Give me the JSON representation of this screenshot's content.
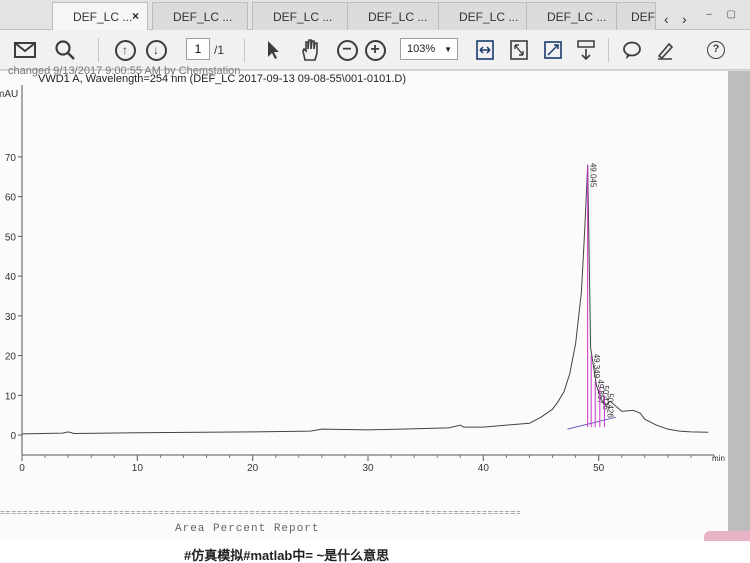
{
  "tabs": [
    {
      "label": "DEF_LC ...",
      "active": true
    },
    {
      "label": "DEF_LC ..."
    },
    {
      "label": "DEF_LC ..."
    },
    {
      "label": "DEF_LC ..."
    },
    {
      "label": "DEF_LC ..."
    },
    {
      "label": "DEF_LC ..."
    },
    {
      "label": "DEF"
    }
  ],
  "toolbar": {
    "page_current": "1",
    "page_total": "/1",
    "zoom": "103%"
  },
  "document": {
    "header_cut": "changed       9/13/2017  9:00:55 AM by  Chemstation",
    "chart_title": "VWD1 A, Wavelength=254 nm (DEF_LC 2017-09-13 09-08-55\\001-0101.D)",
    "report_rule": "==================================================================================================",
    "report_title": "Area Percent Report"
  },
  "caption": "#仿真模拟#matlab中= ~是什么意思",
  "colors": {
    "trace": "#444444",
    "peak_marker": "#cc33cc",
    "baseline": "#6060c0"
  },
  "chart_data": {
    "type": "line",
    "ylabel": "mAU",
    "xlabel": "min",
    "xlim": [
      0,
      60
    ],
    "ylim": [
      -3,
      75
    ],
    "xticks": [
      0,
      10,
      20,
      30,
      40,
      50
    ],
    "yticks": [
      0,
      10,
      20,
      30,
      40,
      50,
      60,
      70
    ],
    "series": [
      {
        "x": [
          0,
          3.5,
          4,
          4.5,
          10,
          20,
          25,
          26,
          30,
          37,
          38,
          38.3,
          40,
          42,
          44,
          45,
          46,
          46.5,
          47,
          47.5,
          48,
          48.5,
          48.8,
          49.05,
          49.3,
          49.8,
          50.2,
          50.6,
          51,
          52,
          53,
          53.6,
          54,
          55,
          56,
          57,
          58,
          59.5
        ],
        "y": [
          0.3,
          0.5,
          0.8,
          0.4,
          0.6,
          0.8,
          1.0,
          1.5,
          1.3,
          1.8,
          2.5,
          2.0,
          2.0,
          2.5,
          3.0,
          4.5,
          6.5,
          8.5,
          11.0,
          15.5,
          23.0,
          36.0,
          52.0,
          68.0,
          22.0,
          12.5,
          9.0,
          7.5,
          8.5,
          6.0,
          6.2,
          5.5,
          4.0,
          2.5,
          1.5,
          1.0,
          0.8,
          0.7
        ]
      }
    ],
    "peak_labels": [
      {
        "x": 49.045,
        "y": 68,
        "text": "49.045"
      },
      {
        "x": 49.349,
        "y": 20,
        "text": "49.349"
      },
      {
        "x": 49.7,
        "y": 13.5,
        "text": "49.867"
      },
      {
        "x": 50.1,
        "y": 12,
        "text": "50.426"
      },
      {
        "x": 50.5,
        "y": 10,
        "text": "50.426"
      }
    ]
  }
}
